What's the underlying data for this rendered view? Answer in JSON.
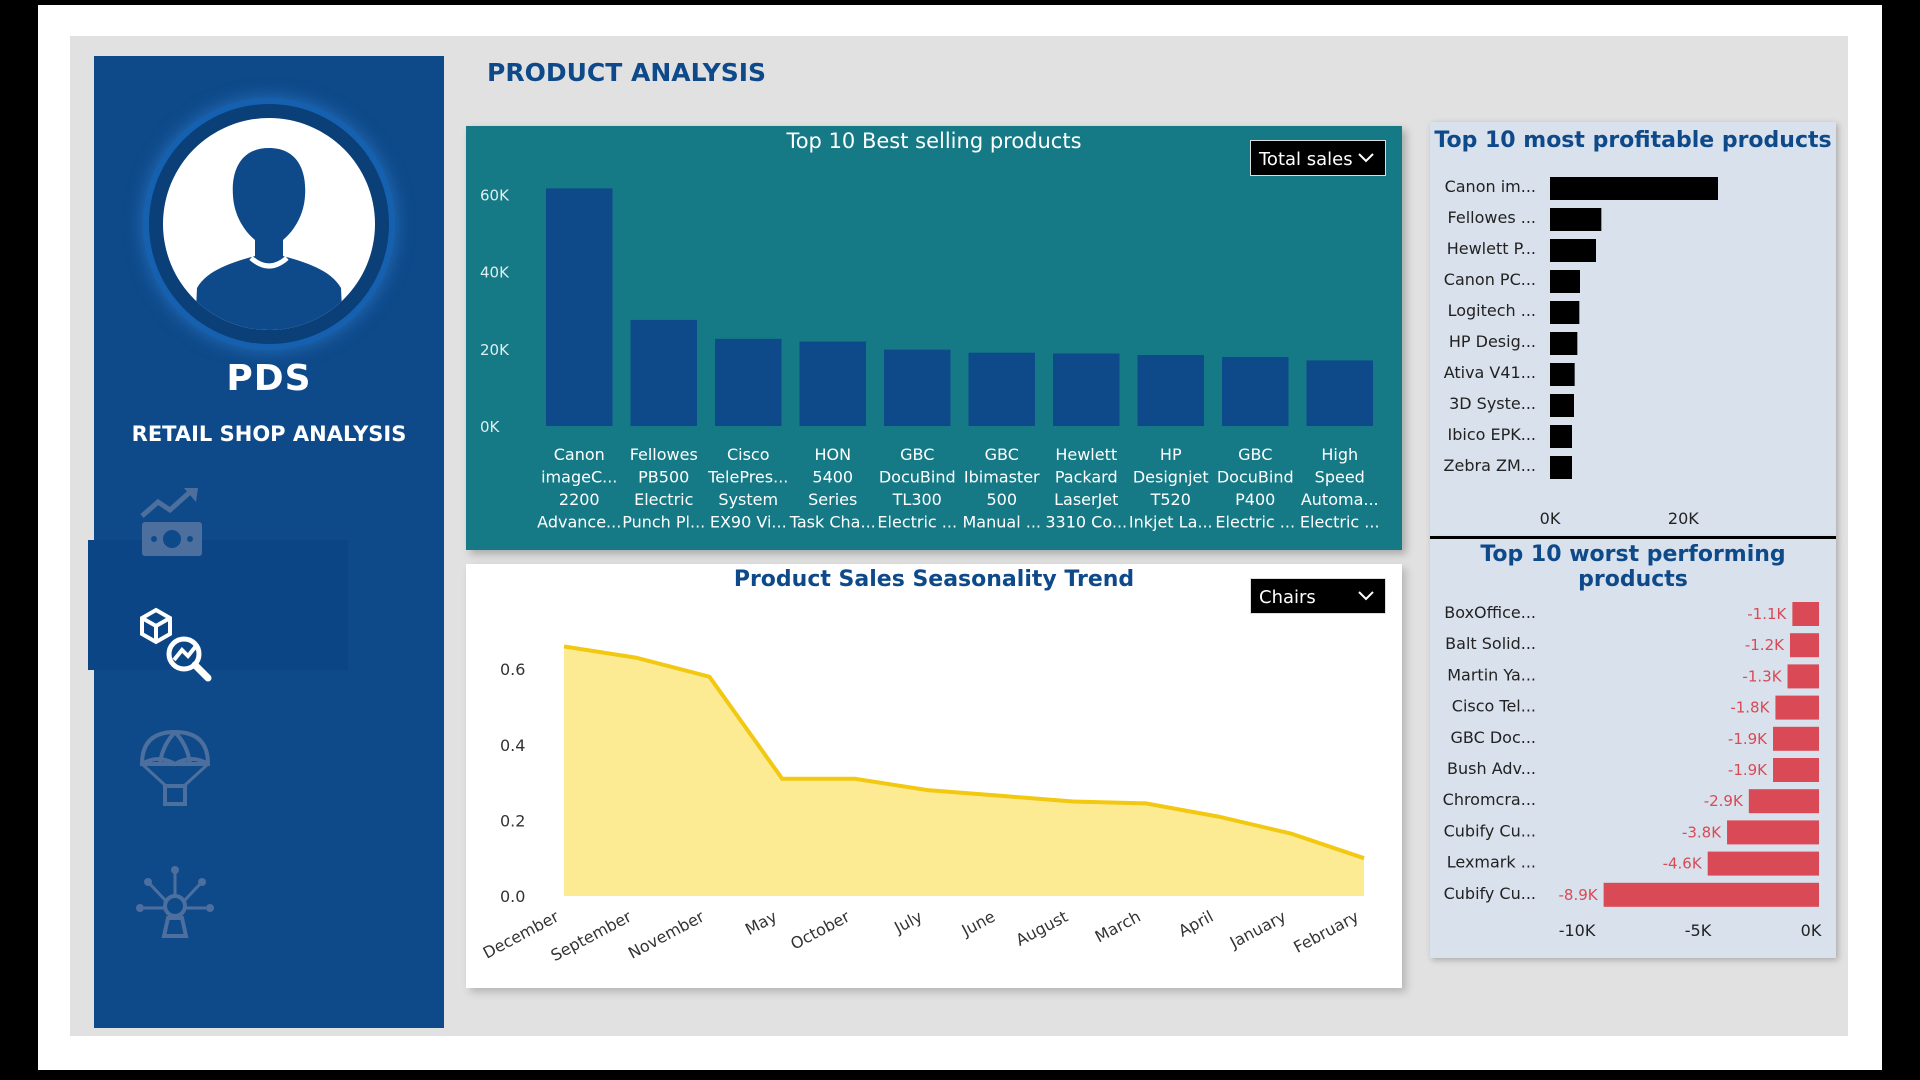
{
  "page": {
    "title": "PRODUCT ANALYSIS"
  },
  "sidebar": {
    "brand": "PDS",
    "subtitle": "RETAIL SHOP ANALYSIS",
    "nav": [
      {
        "icon": "sales-chart-icon",
        "active": false
      },
      {
        "icon": "product-analysis-icon",
        "active": true
      },
      {
        "icon": "parachute-icon",
        "active": false
      },
      {
        "icon": "insights-bulb-icon",
        "active": false
      }
    ]
  },
  "best_selling": {
    "title": "Top 10 Best selling products",
    "dropdown": "Total sales",
    "colors": {
      "bar": "#0e4a8a",
      "background": "#157a86"
    }
  },
  "seasonality": {
    "title": "Product Sales Seasonality Trend",
    "dropdown": "Chairs",
    "colors": {
      "line": "#f2c811",
      "fill": "#fdeb94"
    }
  },
  "profitable": {
    "title": "Top 10 most profitable products",
    "colors": {
      "bar": "#000000"
    }
  },
  "worst": {
    "title": "Top 10 worst performing products",
    "colors": {
      "bar": "#d94a56",
      "label": "#d94a56"
    }
  },
  "chart_data": [
    {
      "type": "bar",
      "title": "Top 10 Best selling products",
      "categories": [
        [
          "Canon",
          "imageC...",
          "2200",
          "Advance..."
        ],
        [
          "Fellowes",
          "PB500",
          "Electric",
          "Punch Pl..."
        ],
        [
          "Cisco",
          "TelePres...",
          "System",
          "EX90 Vi..."
        ],
        [
          "HON",
          "5400",
          "Series",
          "Task Cha..."
        ],
        [
          "GBC",
          "DocuBind",
          "TL300",
          "Electric ..."
        ],
        [
          "GBC",
          "Ibimaster",
          "500",
          "Manual ..."
        ],
        [
          "Hewlett",
          "Packard",
          "LaserJet",
          "3310 Co..."
        ],
        [
          "HP",
          "Designjet",
          "T520",
          "Inkjet La..."
        ],
        [
          "GBC",
          "DocuBind",
          "P400",
          "Electric ..."
        ],
        [
          "High",
          "Speed",
          "Automa...",
          "Electric ..."
        ]
      ],
      "values": [
        61600,
        27500,
        22600,
        21900,
        19800,
        19000,
        18800,
        18400,
        17900,
        17000
      ],
      "yticks": [
        "0K",
        "20K",
        "40K",
        "60K"
      ],
      "ylim": [
        0,
        70000
      ]
    },
    {
      "type": "area",
      "title": "Product Sales Seasonality Trend",
      "categories": [
        "December",
        "September",
        "November",
        "May",
        "October",
        "July",
        "June",
        "August",
        "March",
        "April",
        "January",
        "February"
      ],
      "values": [
        0.66,
        0.63,
        0.58,
        0.31,
        0.31,
        0.28,
        0.265,
        0.25,
        0.245,
        0.21,
        0.165,
        0.1
      ],
      "yticks": [
        "0.0",
        "0.2",
        "0.4",
        "0.6"
      ],
      "ylim": [
        0,
        0.7
      ]
    },
    {
      "type": "bar",
      "title": "Top 10 most profitable products",
      "orientation": "horizontal",
      "categories": [
        "Canon im...",
        "Fellowes ...",
        "Hewlett P...",
        "Canon PC...",
        "Logitech ...",
        "HP Desig...",
        "Ativa V41...",
        "3D Syste...",
        "Ibico EPK...",
        "Zebra ZM..."
      ],
      "values": [
        25200,
        7700,
        6900,
        4500,
        4400,
        4100,
        3700,
        3600,
        3300,
        3300
      ],
      "xticks": [
        "0K",
        "20K"
      ],
      "xlim": [
        0,
        30000
      ]
    },
    {
      "type": "bar",
      "title": "Top 10 worst performing products",
      "orientation": "horizontal",
      "categories": [
        "BoxOffice...",
        "Balt Solid...",
        "Martin Ya...",
        "Cisco Tel...",
        "GBC Doc...",
        "Bush Adv...",
        "Chromcra...",
        "Cubify Cu...",
        "Lexmark ...",
        "Cubify Cu..."
      ],
      "values": [
        -1100,
        -1200,
        -1300,
        -1800,
        -1900,
        -1900,
        -2900,
        -3800,
        -4600,
        -8900
      ],
      "labels": [
        "-1.1K",
        "-1.2K",
        "-1.3K",
        "-1.8K",
        "-1.9K",
        "-1.9K",
        "-2.9K",
        "-3.8K",
        "-4.6K",
        "-8.9K"
      ],
      "xticks": [
        "-10K",
        "-5K",
        "0K"
      ],
      "xlim": [
        -10000,
        0
      ]
    }
  ]
}
